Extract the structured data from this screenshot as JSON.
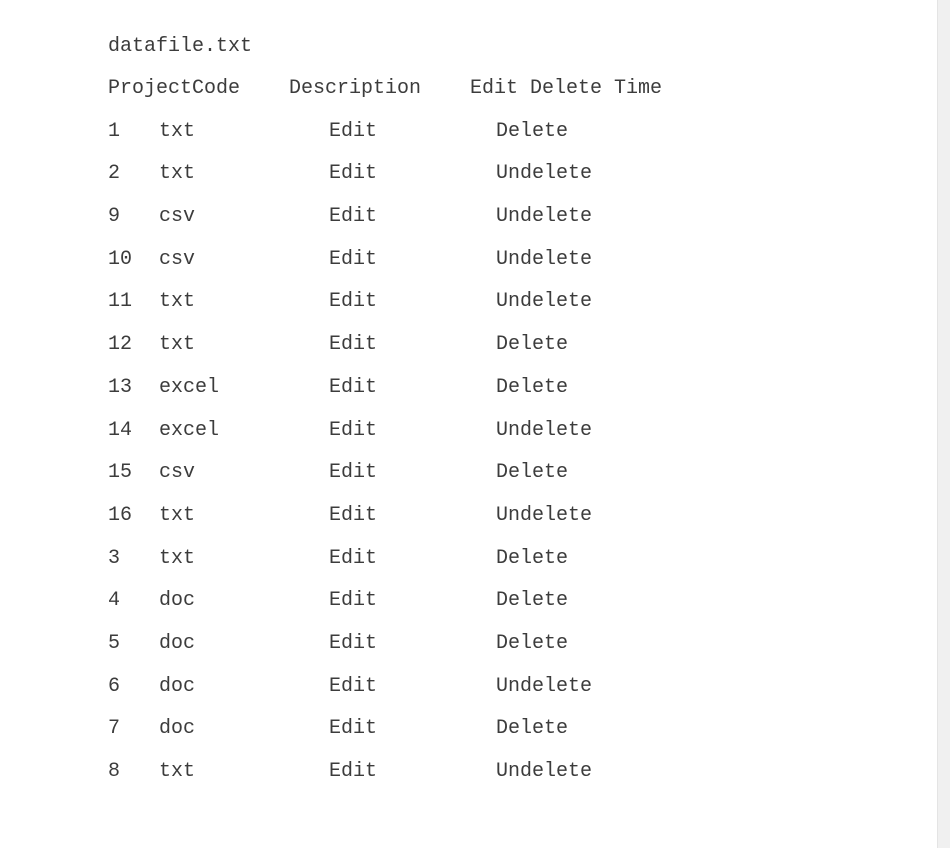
{
  "file": {
    "name": "datafile.txt"
  },
  "header": {
    "project_code": "ProjectCode",
    "description": "Description",
    "edit_delete_time": "Edit Delete Time"
  },
  "rows": [
    {
      "id": "1",
      "type": "txt",
      "edit": "Edit",
      "action": "Delete"
    },
    {
      "id": "2",
      "type": "txt",
      "edit": "Edit",
      "action": "Undelete"
    },
    {
      "id": "9",
      "type": "csv",
      "edit": "Edit",
      "action": "Undelete"
    },
    {
      "id": "10",
      "type": "csv",
      "edit": "Edit",
      "action": "Undelete"
    },
    {
      "id": "11",
      "type": "txt",
      "edit": "Edit",
      "action": "Undelete"
    },
    {
      "id": "12",
      "type": "txt",
      "edit": "Edit",
      "action": "Delete"
    },
    {
      "id": "13",
      "type": "excel",
      "edit": "Edit",
      "action": "Delete"
    },
    {
      "id": "14",
      "type": "excel",
      "edit": "Edit",
      "action": "Undelete"
    },
    {
      "id": "15",
      "type": "csv",
      "edit": "Edit",
      "action": "Delete"
    },
    {
      "id": "16",
      "type": "txt",
      "edit": "Edit",
      "action": "Undelete"
    },
    {
      "id": "3",
      "type": "txt",
      "edit": "Edit",
      "action": "Delete"
    },
    {
      "id": "4",
      "type": "doc",
      "edit": "Edit",
      "action": "Delete"
    },
    {
      "id": "5",
      "type": "doc",
      "edit": "Edit",
      "action": "Delete"
    },
    {
      "id": "6",
      "type": "doc",
      "edit": "Edit",
      "action": "Undelete"
    },
    {
      "id": "7",
      "type": "doc",
      "edit": "Edit",
      "action": "Delete"
    },
    {
      "id": "8",
      "type": "txt",
      "edit": "Edit",
      "action": "Undelete"
    }
  ]
}
